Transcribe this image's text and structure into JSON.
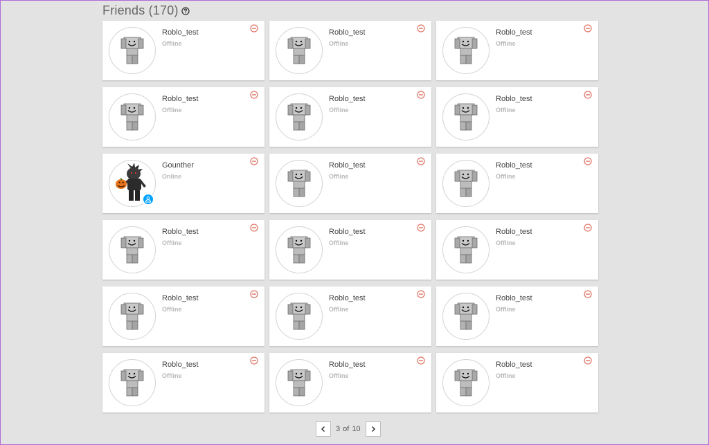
{
  "header": {
    "title": "Friends (170)",
    "help_icon": "question-circle-icon"
  },
  "friends": [
    {
      "name": "Roblo_test",
      "status": "Offline",
      "avatar": "default-block-avatar"
    },
    {
      "name": "Roblo_test",
      "status": "Offline",
      "avatar": "default-block-avatar"
    },
    {
      "name": "Roblo_test",
      "status": "Offline",
      "avatar": "default-block-avatar"
    },
    {
      "name": "Roblo_test",
      "status": "Offline",
      "avatar": "default-block-avatar"
    },
    {
      "name": "Roblo_test",
      "status": "Offline",
      "avatar": "default-block-avatar"
    },
    {
      "name": "Roblo_test",
      "status": "Offline",
      "avatar": "default-block-avatar"
    },
    {
      "name": "Gounther",
      "status": "Online",
      "avatar": "custom-character-avatar",
      "presence_icon": "user-presence-icon"
    },
    {
      "name": "Roblo_test",
      "status": "Offline",
      "avatar": "default-block-avatar"
    },
    {
      "name": "Roblo_test",
      "status": "Offline",
      "avatar": "default-block-avatar"
    },
    {
      "name": "Roblo_test",
      "status": "Offline",
      "avatar": "default-block-avatar"
    },
    {
      "name": "Roblo_test",
      "status": "Offline",
      "avatar": "default-block-avatar"
    },
    {
      "name": "Roblo_test",
      "status": "Offline",
      "avatar": "default-block-avatar"
    },
    {
      "name": "Roblo_test",
      "status": "Offline",
      "avatar": "default-block-avatar"
    },
    {
      "name": "Roblo_test",
      "status": "Offline",
      "avatar": "default-block-avatar"
    },
    {
      "name": "Roblo_test",
      "status": "Offline",
      "avatar": "default-block-avatar"
    },
    {
      "name": "Roblo_test",
      "status": "Offline",
      "avatar": "default-block-avatar"
    },
    {
      "name": "Roblo_test",
      "status": "Offline",
      "avatar": "default-block-avatar"
    },
    {
      "name": "Roblo_test",
      "status": "Offline",
      "avatar": "default-block-avatar"
    }
  ],
  "pagination": {
    "current_page": "3",
    "of_label": "of",
    "total_pages": "10",
    "prev_icon": "chevron-left-icon",
    "next_icon": "chevron-right-icon"
  },
  "colors": {
    "background": "#e3e3e3",
    "remove_icon": "#e07a6a",
    "presence_badge": "#00a2ff",
    "status_text": "#b8b8b8"
  }
}
